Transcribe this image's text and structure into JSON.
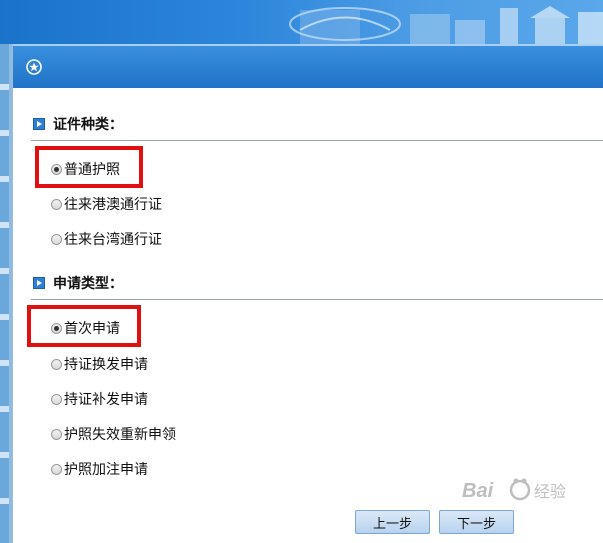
{
  "document_type": {
    "title": "证件种类：",
    "options": [
      {
        "label": "普通护照",
        "checked": true
      },
      {
        "label": "往来港澳通行证",
        "checked": false
      },
      {
        "label": "往来台湾通行证",
        "checked": false
      }
    ]
  },
  "application_type": {
    "title": "申请类型：",
    "options": [
      {
        "label": "首次申请",
        "checked": true
      },
      {
        "label": "持证换发申请",
        "checked": false
      },
      {
        "label": "持证补发申请",
        "checked": false
      },
      {
        "label": "护照失效重新申领",
        "checked": false
      },
      {
        "label": "护照加注申请",
        "checked": false
      }
    ]
  },
  "buttons": {
    "prev": "上一步",
    "next": "下一步"
  },
  "watermark": {
    "text": "Baidu 经验"
  },
  "colors": {
    "header_blue": "#1f74c8",
    "highlight_red": "#e01010"
  }
}
